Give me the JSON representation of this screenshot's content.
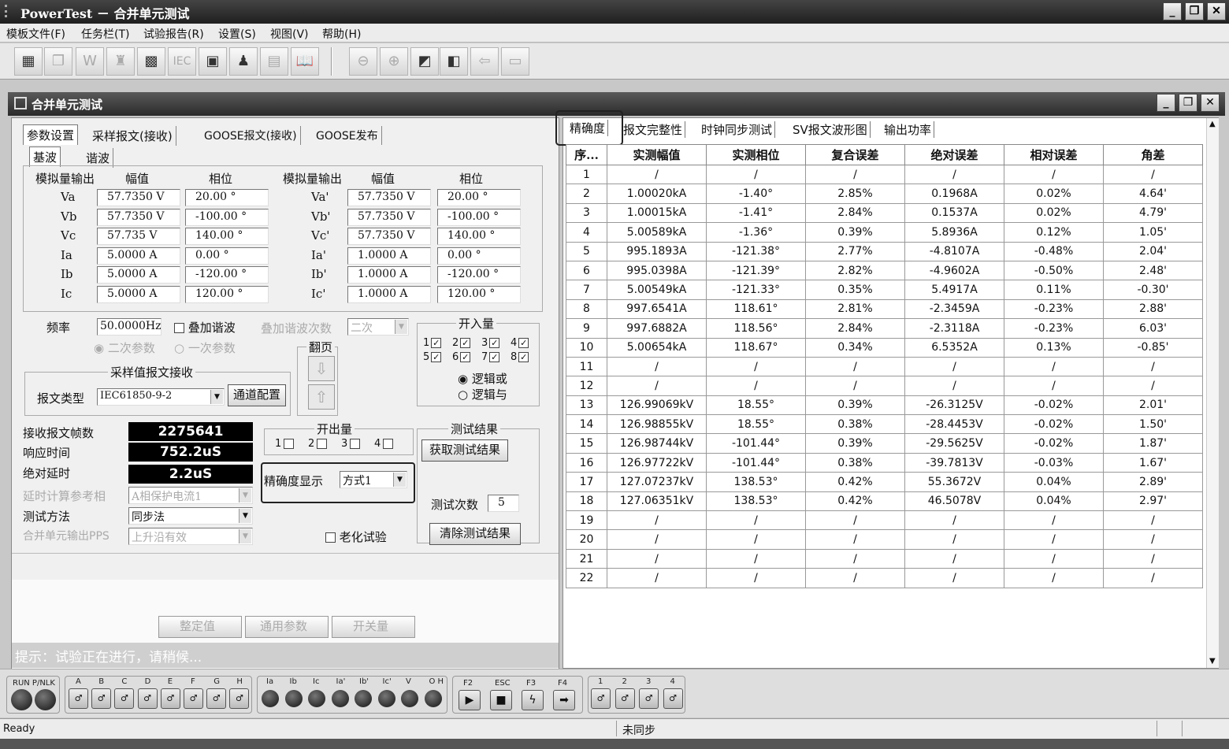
{
  "app": {
    "title": "PowerTest － 合并单元测试",
    "win_min": "_",
    "win_max": "❐",
    "win_close": "✕"
  },
  "menu": [
    "模板文件(F)",
    "任务栏(T)",
    "试验报告(R)",
    "设置(S)",
    "视图(V)",
    "帮助(H)"
  ],
  "toolbar": {
    "icons": [
      {
        "name": "table-icon",
        "glyph": "▦"
      },
      {
        "name": "copy-icon",
        "glyph": "❐"
      },
      {
        "name": "word-icon",
        "glyph": "W"
      },
      {
        "name": "person-icon",
        "glyph": "♜"
      },
      {
        "name": "calc-icon",
        "glyph": "▩"
      },
      {
        "name": "iec-icon",
        "glyph": "IEC"
      },
      {
        "name": "chip-icon",
        "glyph": "▣"
      },
      {
        "name": "stamp-icon",
        "glyph": "♟"
      },
      {
        "name": "grid-icon",
        "glyph": "▤"
      },
      {
        "name": "book-icon",
        "glyph": "📖"
      },
      {
        "name": "zoom-out-icon",
        "glyph": "⊖"
      },
      {
        "name": "zoom-in-icon",
        "glyph": "⊕"
      },
      {
        "name": "chart-icon",
        "glyph": "◩"
      },
      {
        "name": "export-icon",
        "glyph": "◧"
      },
      {
        "name": "back-icon",
        "glyph": "⇦"
      },
      {
        "name": "monitor-icon",
        "glyph": "▭"
      }
    ]
  },
  "child": {
    "title": "合并单元测试"
  },
  "left": {
    "tabs": [
      "参数设置",
      "采样报文(接收)",
      "GOOSE报文(接收)",
      "GOOSE发布"
    ],
    "subtabs": [
      "基波",
      "谐波"
    ],
    "headers": {
      "out": "模拟量输出",
      "amp": "幅值",
      "phase": "相位"
    },
    "rows1": [
      {
        "n": "Va",
        "a": "57.7350 V",
        "p": "20.00 °"
      },
      {
        "n": "Vb",
        "a": "57.7350 V",
        "p": "-100.00 °"
      },
      {
        "n": "Vc",
        "a": "57.735 V",
        "p": "140.00 °"
      },
      {
        "n": "Ia",
        "a": "5.0000 A",
        "p": "0.00 °"
      },
      {
        "n": "Ib",
        "a": "5.0000 A",
        "p": "-120.00 °"
      },
      {
        "n": "Ic",
        "a": "5.0000 A",
        "p": "120.00 °"
      }
    ],
    "rows2": [
      {
        "n": "Va'",
        "a": "57.7350 V",
        "p": "20.00 °"
      },
      {
        "n": "Vb'",
        "a": "57.7350 V",
        "p": "-100.00 °"
      },
      {
        "n": "Vc'",
        "a": "57.7350 V",
        "p": "140.00 °"
      },
      {
        "n": "Ia'",
        "a": "1.0000 A",
        "p": "0.00 °"
      },
      {
        "n": "Ib'",
        "a": "1.0000 A",
        "p": "-120.00 °"
      },
      {
        "n": "Ic'",
        "a": "1.0000 A",
        "p": "120.00 °"
      }
    ],
    "freq_label": "频率",
    "freq": "50.0000Hz",
    "harm": "叠加谐波",
    "harm_count_label": "叠加谐波次数",
    "harm_count": "二次",
    "radio_secondary": "二次参数",
    "radio_primary": "一次参数",
    "page_label": "翻页",
    "binary_in": "开入量",
    "bin_labels": [
      "1",
      "2",
      "3",
      "4",
      "5",
      "6",
      "7",
      "8"
    ],
    "logic_or": "逻辑或",
    "logic_and": "逻辑与",
    "sv_group": "采样值报文接收",
    "msg_type_label": "报文类型",
    "msg_type": "IEC61850-9-2",
    "chan_cfg": "通道配置",
    "recv_label": "接收报文帧数",
    "recv": "2275641",
    "resp_label": "响应时间",
    "resp": "752.2uS",
    "delay_label": "绝对延时",
    "delay": "2.2uS",
    "delay_ref_label": "延时计算参考相",
    "delay_ref": "A相保护电流1",
    "method_label": "测试方法",
    "method": "同步法",
    "pps_label": "合并单元输出PPS",
    "pps": "上升沿有效",
    "binary_out": "开出量",
    "bout_labels": [
      "1",
      "2",
      "3",
      "4"
    ],
    "acc_label": "精确度显示",
    "acc_mode": "方式1",
    "result_group": "测试结果",
    "get_result": "获取测试结果",
    "count_label": "测试次数",
    "count": "5",
    "clear_result": "清除测试结果",
    "aging": "老化试验",
    "bottom_tabs": [
      "整定值",
      "通用参数",
      "开关量"
    ],
    "hint": "提示：试验正在进行，请稍候..."
  },
  "right": {
    "tabs": [
      "精确度",
      "报文完整性",
      "时钟同步测试",
      "SV报文波形图",
      "输出功率"
    ],
    "columns": [
      "序...",
      "实测幅值",
      "实测相位",
      "复合误差",
      "绝对误差",
      "相对误差",
      "角差"
    ],
    "rows": [
      [
        "1",
        "/",
        "/",
        "/",
        "/",
        "/",
        "/"
      ],
      [
        "2",
        "1.00020kA",
        "-1.40°",
        "2.85%",
        "0.1968A",
        "0.02%",
        "4.64'"
      ],
      [
        "3",
        "1.00015kA",
        "-1.41°",
        "2.84%",
        "0.1537A",
        "0.02%",
        "4.79'"
      ],
      [
        "4",
        "5.00589kA",
        "-1.36°",
        "0.39%",
        "5.8936A",
        "0.12%",
        "1.05'"
      ],
      [
        "5",
        "995.1893A",
        "-121.38°",
        "2.77%",
        "-4.8107A",
        "-0.48%",
        "2.04'"
      ],
      [
        "6",
        "995.0398A",
        "-121.39°",
        "2.82%",
        "-4.9602A",
        "-0.50%",
        "2.48'"
      ],
      [
        "7",
        "5.00549kA",
        "-121.33°",
        "0.35%",
        "5.4917A",
        "0.11%",
        "-0.30'"
      ],
      [
        "8",
        "997.6541A",
        "118.61°",
        "2.81%",
        "-2.3459A",
        "-0.23%",
        "2.88'"
      ],
      [
        "9",
        "997.6882A",
        "118.56°",
        "2.84%",
        "-2.3118A",
        "-0.23%",
        "6.03'"
      ],
      [
        "10",
        "5.00654kA",
        "118.67°",
        "0.34%",
        "6.5352A",
        "0.13%",
        "-0.85'"
      ],
      [
        "11",
        "/",
        "/",
        "/",
        "/",
        "/",
        "/"
      ],
      [
        "12",
        "/",
        "/",
        "/",
        "/",
        "/",
        "/"
      ],
      [
        "13",
        "126.99069kV",
        "18.55°",
        "0.39%",
        "-26.3125V",
        "-0.02%",
        "2.01'"
      ],
      [
        "14",
        "126.98855kV",
        "18.55°",
        "0.38%",
        "-28.4453V",
        "-0.02%",
        "1.50'"
      ],
      [
        "15",
        "126.98744kV",
        "-101.44°",
        "0.39%",
        "-29.5625V",
        "-0.02%",
        "1.87'"
      ],
      [
        "16",
        "126.97722kV",
        "-101.44°",
        "0.38%",
        "-39.7813V",
        "-0.03%",
        "1.67'"
      ],
      [
        "17",
        "127.07237kV",
        "138.53°",
        "0.42%",
        "55.3672V",
        "0.04%",
        "2.89'"
      ],
      [
        "18",
        "127.06351kV",
        "138.53°",
        "0.42%",
        "46.5078V",
        "0.04%",
        "2.97'"
      ],
      [
        "19",
        "/",
        "/",
        "/",
        "/",
        "/",
        "/"
      ],
      [
        "20",
        "/",
        "/",
        "/",
        "/",
        "/",
        "/"
      ],
      [
        "21",
        "/",
        "/",
        "/",
        "/",
        "/",
        "/"
      ],
      [
        "22",
        "/",
        "/",
        "/",
        "/",
        "/",
        "/"
      ]
    ]
  },
  "bottom": {
    "run_label": "RUN P/NLK",
    "sw1": [
      "A",
      "B",
      "C",
      "D",
      "E",
      "F",
      "G",
      "H"
    ],
    "lamps": [
      "Ia",
      "Ib",
      "Ic",
      "Ia'",
      "Ib'",
      "Ic'",
      "V",
      "O H"
    ],
    "keys": [
      {
        "k": "F2",
        "g": "▶"
      },
      {
        "k": "ESC",
        "g": "■"
      },
      {
        "k": "F3",
        "g": "ϟ"
      },
      {
        "k": "F4",
        "g": "➡"
      }
    ],
    "sw2": [
      "1",
      "2",
      "3",
      "4"
    ]
  },
  "status": {
    "left": "Ready",
    "mid": "未同步"
  }
}
